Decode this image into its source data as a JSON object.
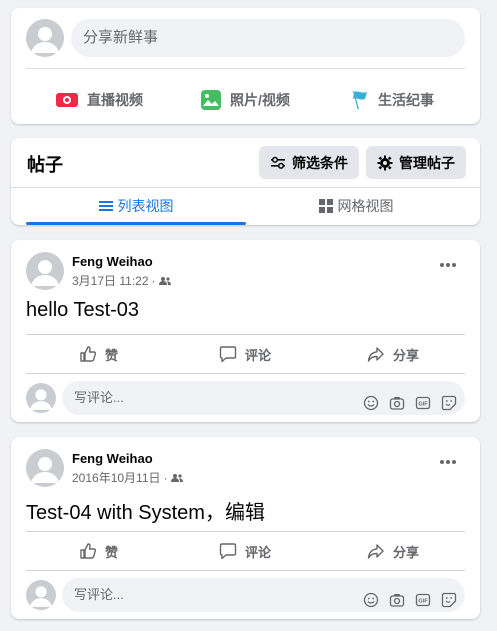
{
  "composer": {
    "placeholder": "分享新鲜事",
    "actions": [
      {
        "label": "直播视频",
        "icon": "live-video-icon",
        "color": "#f02849"
      },
      {
        "label": "照片/视频",
        "icon": "photo-video-icon",
        "color": "#45bd62"
      },
      {
        "label": "生活纪事",
        "icon": "flag-icon",
        "color": "#39afd5"
      }
    ]
  },
  "posts_header": {
    "title": "帖子",
    "filter_label": "筛选条件",
    "manage_label": "管理帖子",
    "tabs": [
      {
        "label": "列表视图",
        "active": true
      },
      {
        "label": "网格视图",
        "active": false
      }
    ]
  },
  "posts": [
    {
      "author": "Feng Weihao",
      "date": "3月17日 11:22",
      "separator": "·",
      "content": "hello Test-03",
      "like_label": "赞",
      "comment_label": "评论",
      "share_label": "分享",
      "comment_placeholder": "写评论..."
    },
    {
      "author": "Feng Weihao",
      "date": "2016年10月11日",
      "separator": "·",
      "content": "Test-04 with System，编辑",
      "like_label": "赞",
      "comment_label": "评论",
      "share_label": "分享",
      "comment_placeholder": "写评论..."
    }
  ],
  "colors": {
    "accent": "#1b74e4",
    "background": "#f0f2f5",
    "secondary_text": "#65676b"
  }
}
